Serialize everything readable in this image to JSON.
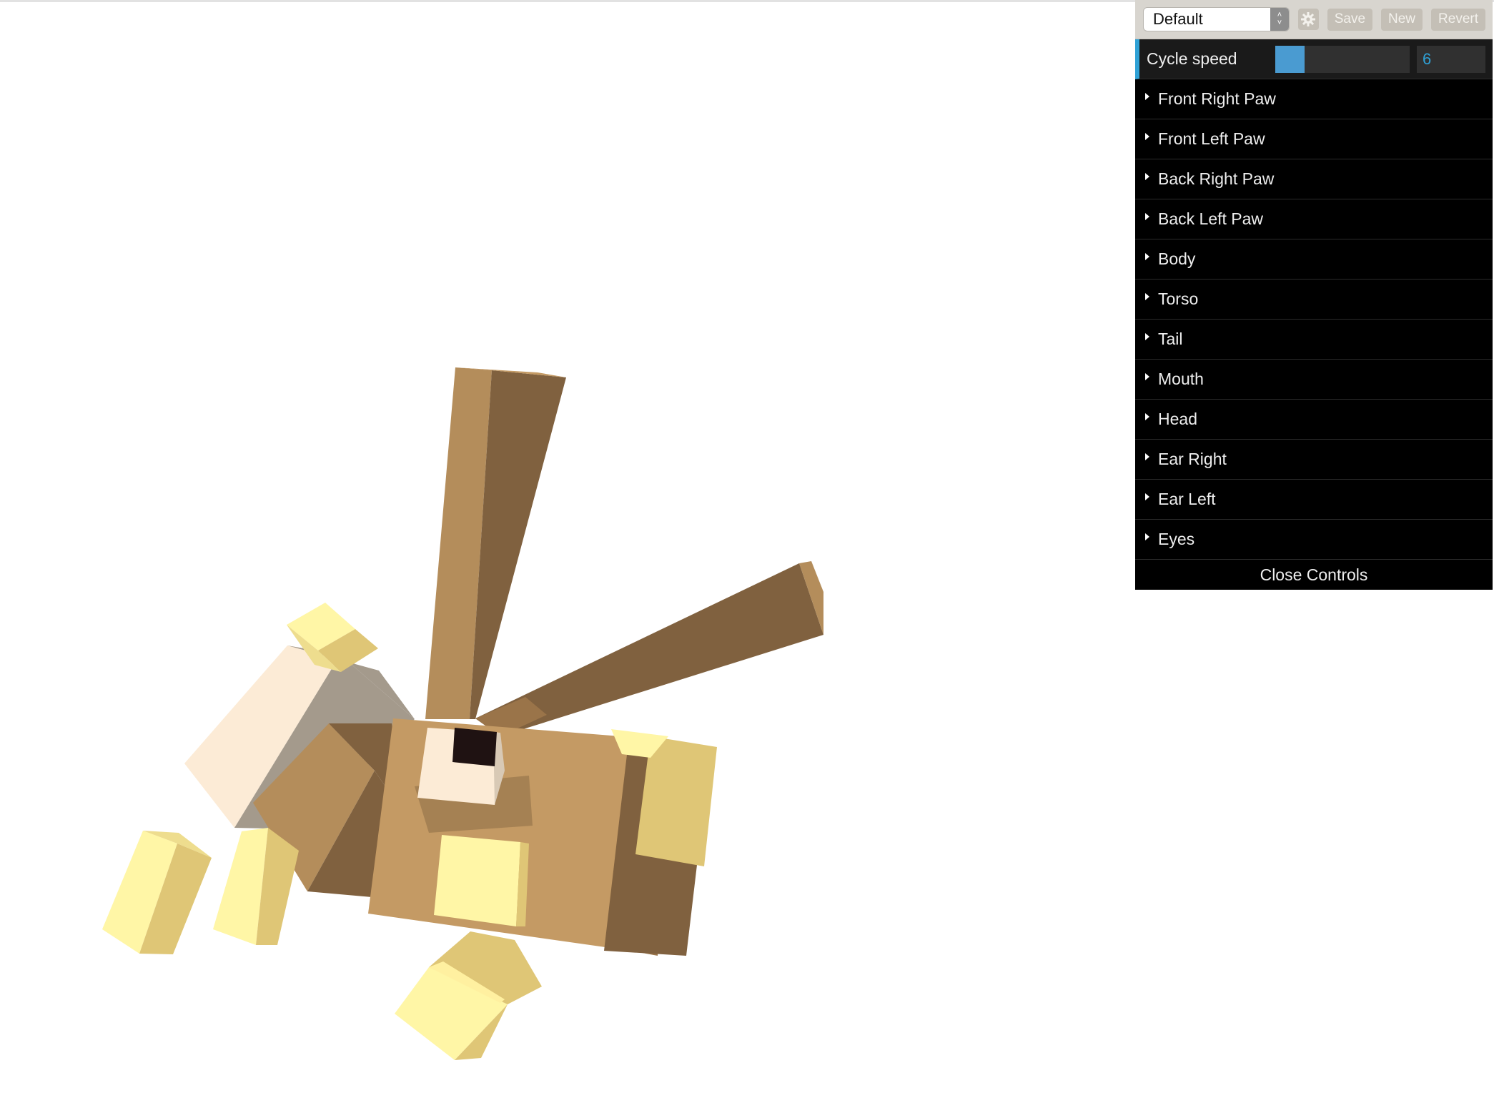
{
  "gui": {
    "preset": {
      "selected": "Default"
    },
    "buttons": {
      "save": "Save",
      "new": "New",
      "revert": "Revert"
    },
    "cycle_speed": {
      "label": "Cycle speed",
      "value": "6",
      "fill_fraction": 0.22
    },
    "folders": [
      {
        "label": "Front Right Paw"
      },
      {
        "label": "Front Left Paw"
      },
      {
        "label": "Back Right Paw"
      },
      {
        "label": "Back Left Paw"
      },
      {
        "label": "Body"
      },
      {
        "label": "Torso"
      },
      {
        "label": "Tail"
      },
      {
        "label": "Mouth"
      },
      {
        "label": "Head"
      },
      {
        "label": "Ear Right"
      },
      {
        "label": "Ear Left"
      },
      {
        "label": "Eyes"
      }
    ],
    "close_label": "Close Controls"
  },
  "icons": {
    "preset_arrows": "up-down-chevron-icon",
    "settings": "gear-icon",
    "folder_caret": "caret-right-icon"
  },
  "colors": {
    "accent": "#2fa1d6",
    "slider_fill": "#4a9bd1",
    "panel_bg": "#000000",
    "header_bg": "#d8d5cf",
    "button_bg": "#c4bfb6",
    "model_brown": "#c49a64",
    "model_dark_brown": "#80613f",
    "model_cream": "#fcebd6",
    "model_yellow": "#fff6a6"
  }
}
